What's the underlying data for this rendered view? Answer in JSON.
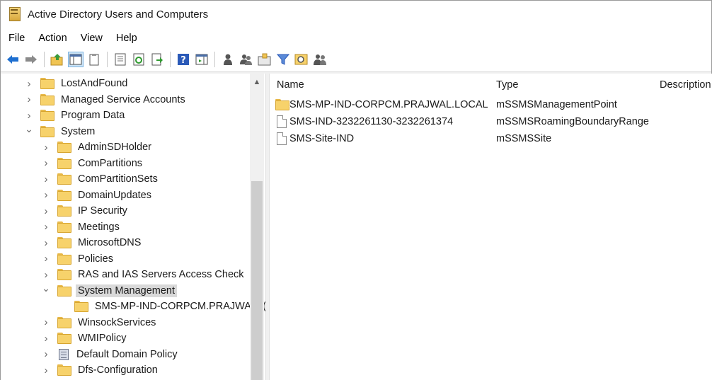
{
  "window": {
    "title": "Active Directory Users and Computers"
  },
  "menu": {
    "file": "File",
    "action": "Action",
    "view": "View",
    "help": "Help"
  },
  "toolbar": {
    "buttons": [
      "back-arrow-icon",
      "forward-arrow-icon",
      "up-folder-icon",
      "show-console-tree-icon",
      "copy-icon",
      "properties-icon",
      "refresh-icon",
      "export-list-icon",
      "help-icon",
      "action-pane-icon",
      "new-user-icon",
      "new-group-icon",
      "new-ou-icon",
      "filter-icon",
      "find-icon",
      "add-to-group-icon"
    ]
  },
  "tree": {
    "items": [
      {
        "label": "LostAndFound",
        "level": 0,
        "expanded": false,
        "icon": "folder"
      },
      {
        "label": "Managed Service Accounts",
        "level": 0,
        "expanded": false,
        "icon": "folder"
      },
      {
        "label": "Program Data",
        "level": 0,
        "expanded": false,
        "icon": "folder"
      },
      {
        "label": "System",
        "level": 0,
        "expanded": true,
        "icon": "folder"
      },
      {
        "label": "AdminSDHolder",
        "level": 1,
        "expanded": false,
        "icon": "folder"
      },
      {
        "label": "ComPartitions",
        "level": 1,
        "expanded": false,
        "icon": "folder"
      },
      {
        "label": "ComPartitionSets",
        "level": 1,
        "expanded": false,
        "icon": "folder"
      },
      {
        "label": "DomainUpdates",
        "level": 1,
        "expanded": false,
        "icon": "folder"
      },
      {
        "label": "IP Security",
        "level": 1,
        "expanded": false,
        "icon": "folder"
      },
      {
        "label": "Meetings",
        "level": 1,
        "expanded": false,
        "icon": "folder"
      },
      {
        "label": "MicrosoftDNS",
        "level": 1,
        "expanded": false,
        "icon": "folder"
      },
      {
        "label": "Policies",
        "level": 1,
        "expanded": false,
        "icon": "folder"
      },
      {
        "label": "RAS and IAS Servers Access Check",
        "level": 1,
        "expanded": false,
        "icon": "folder"
      },
      {
        "label": "System Management",
        "level": 1,
        "expanded": true,
        "icon": "folder",
        "selected": true
      },
      {
        "label": "SMS-MP-IND-CORPCM.PRAJWALL(",
        "level": 2,
        "expanded": null,
        "icon": "folder"
      },
      {
        "label": "WinsockServices",
        "level": 1,
        "expanded": false,
        "icon": "folder"
      },
      {
        "label": "WMIPolicy",
        "level": 1,
        "expanded": false,
        "icon": "folder"
      },
      {
        "label": "Default Domain Policy",
        "level": 1,
        "expanded": false,
        "icon": "gpo"
      },
      {
        "label": "Dfs-Configuration",
        "level": 1,
        "expanded": false,
        "icon": "folder"
      }
    ]
  },
  "list": {
    "columns": {
      "name": "Name",
      "type": "Type",
      "description": "Description"
    },
    "rows": [
      {
        "name": "SMS-MP-IND-CORPCM.PRAJWAL.LOCAL",
        "type": "mSSMSManagementPoint",
        "icon": "folder"
      },
      {
        "name": "SMS-IND-3232261130-3232261374",
        "type": "mSSMSRoamingBoundaryRange",
        "icon": "document"
      },
      {
        "name": "SMS-Site-IND",
        "type": "mSSMSSite",
        "icon": "document"
      }
    ]
  },
  "colors": {
    "selection": "#d9d9d9",
    "folder": "#f7d26b",
    "accent": "#1e6fd0"
  }
}
